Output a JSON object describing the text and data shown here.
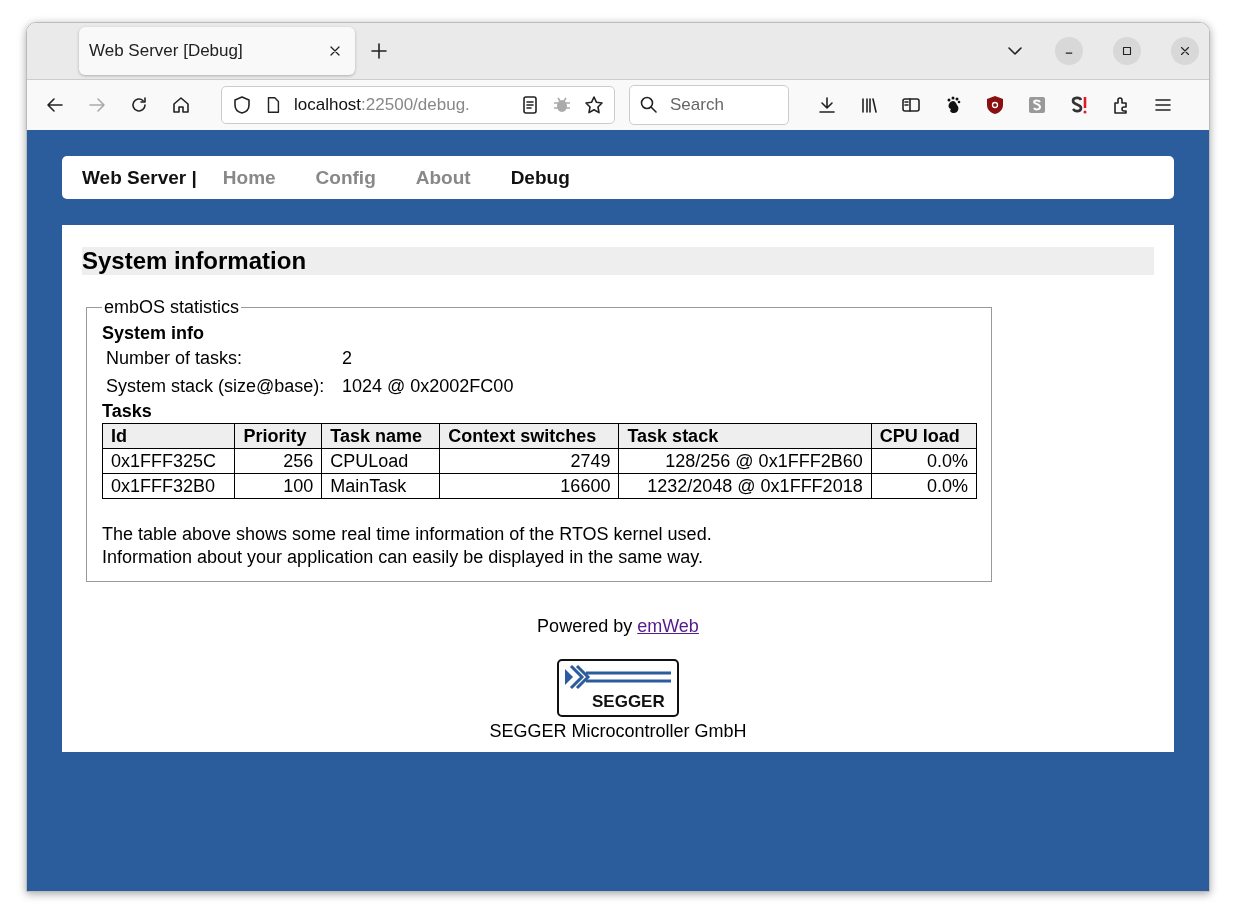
{
  "browser": {
    "tab_title": "Web Server [Debug]",
    "url_host": "localhost",
    "url_rest": ":22500/debug.",
    "search_placeholder": "Search"
  },
  "nav": {
    "brand": "Web Server |",
    "items": [
      {
        "label": "Home",
        "selected": false
      },
      {
        "label": "Config",
        "selected": false
      },
      {
        "label": "About",
        "selected": false
      },
      {
        "label": "Debug",
        "selected": true
      }
    ]
  },
  "page": {
    "heading": "System information",
    "legend": "embOS statistics",
    "system_info_title": "System info",
    "info_rows": [
      {
        "label": "Number of tasks:",
        "value": "2"
      },
      {
        "label": "System stack (size@base):",
        "value": "1024 @ 0x2002FC00"
      }
    ],
    "tasks_title": "Tasks",
    "table": {
      "columns": [
        "Id",
        "Priority",
        "Task name",
        "Context switches",
        "Task stack",
        "CPU load"
      ],
      "rows": [
        [
          "0x1FFF325C",
          "256",
          "CPULoad",
          "2749",
          "128/256 @ 0x1FFF2B60",
          "0.0%"
        ],
        [
          "0x1FFF32B0",
          "100",
          "MainTask",
          "16600",
          "1232/2048 @ 0x1FFF2018",
          "0.0%"
        ]
      ]
    },
    "notes": [
      "The table above shows some real time information of the RTOS kernel used.",
      "Information about your application can easily be displayed in the same way."
    ],
    "powered_by": "Powered by",
    "powered_link": "emWeb",
    "logo_text": "SEGGER",
    "company": "SEGGER Microcontroller GmbH"
  }
}
